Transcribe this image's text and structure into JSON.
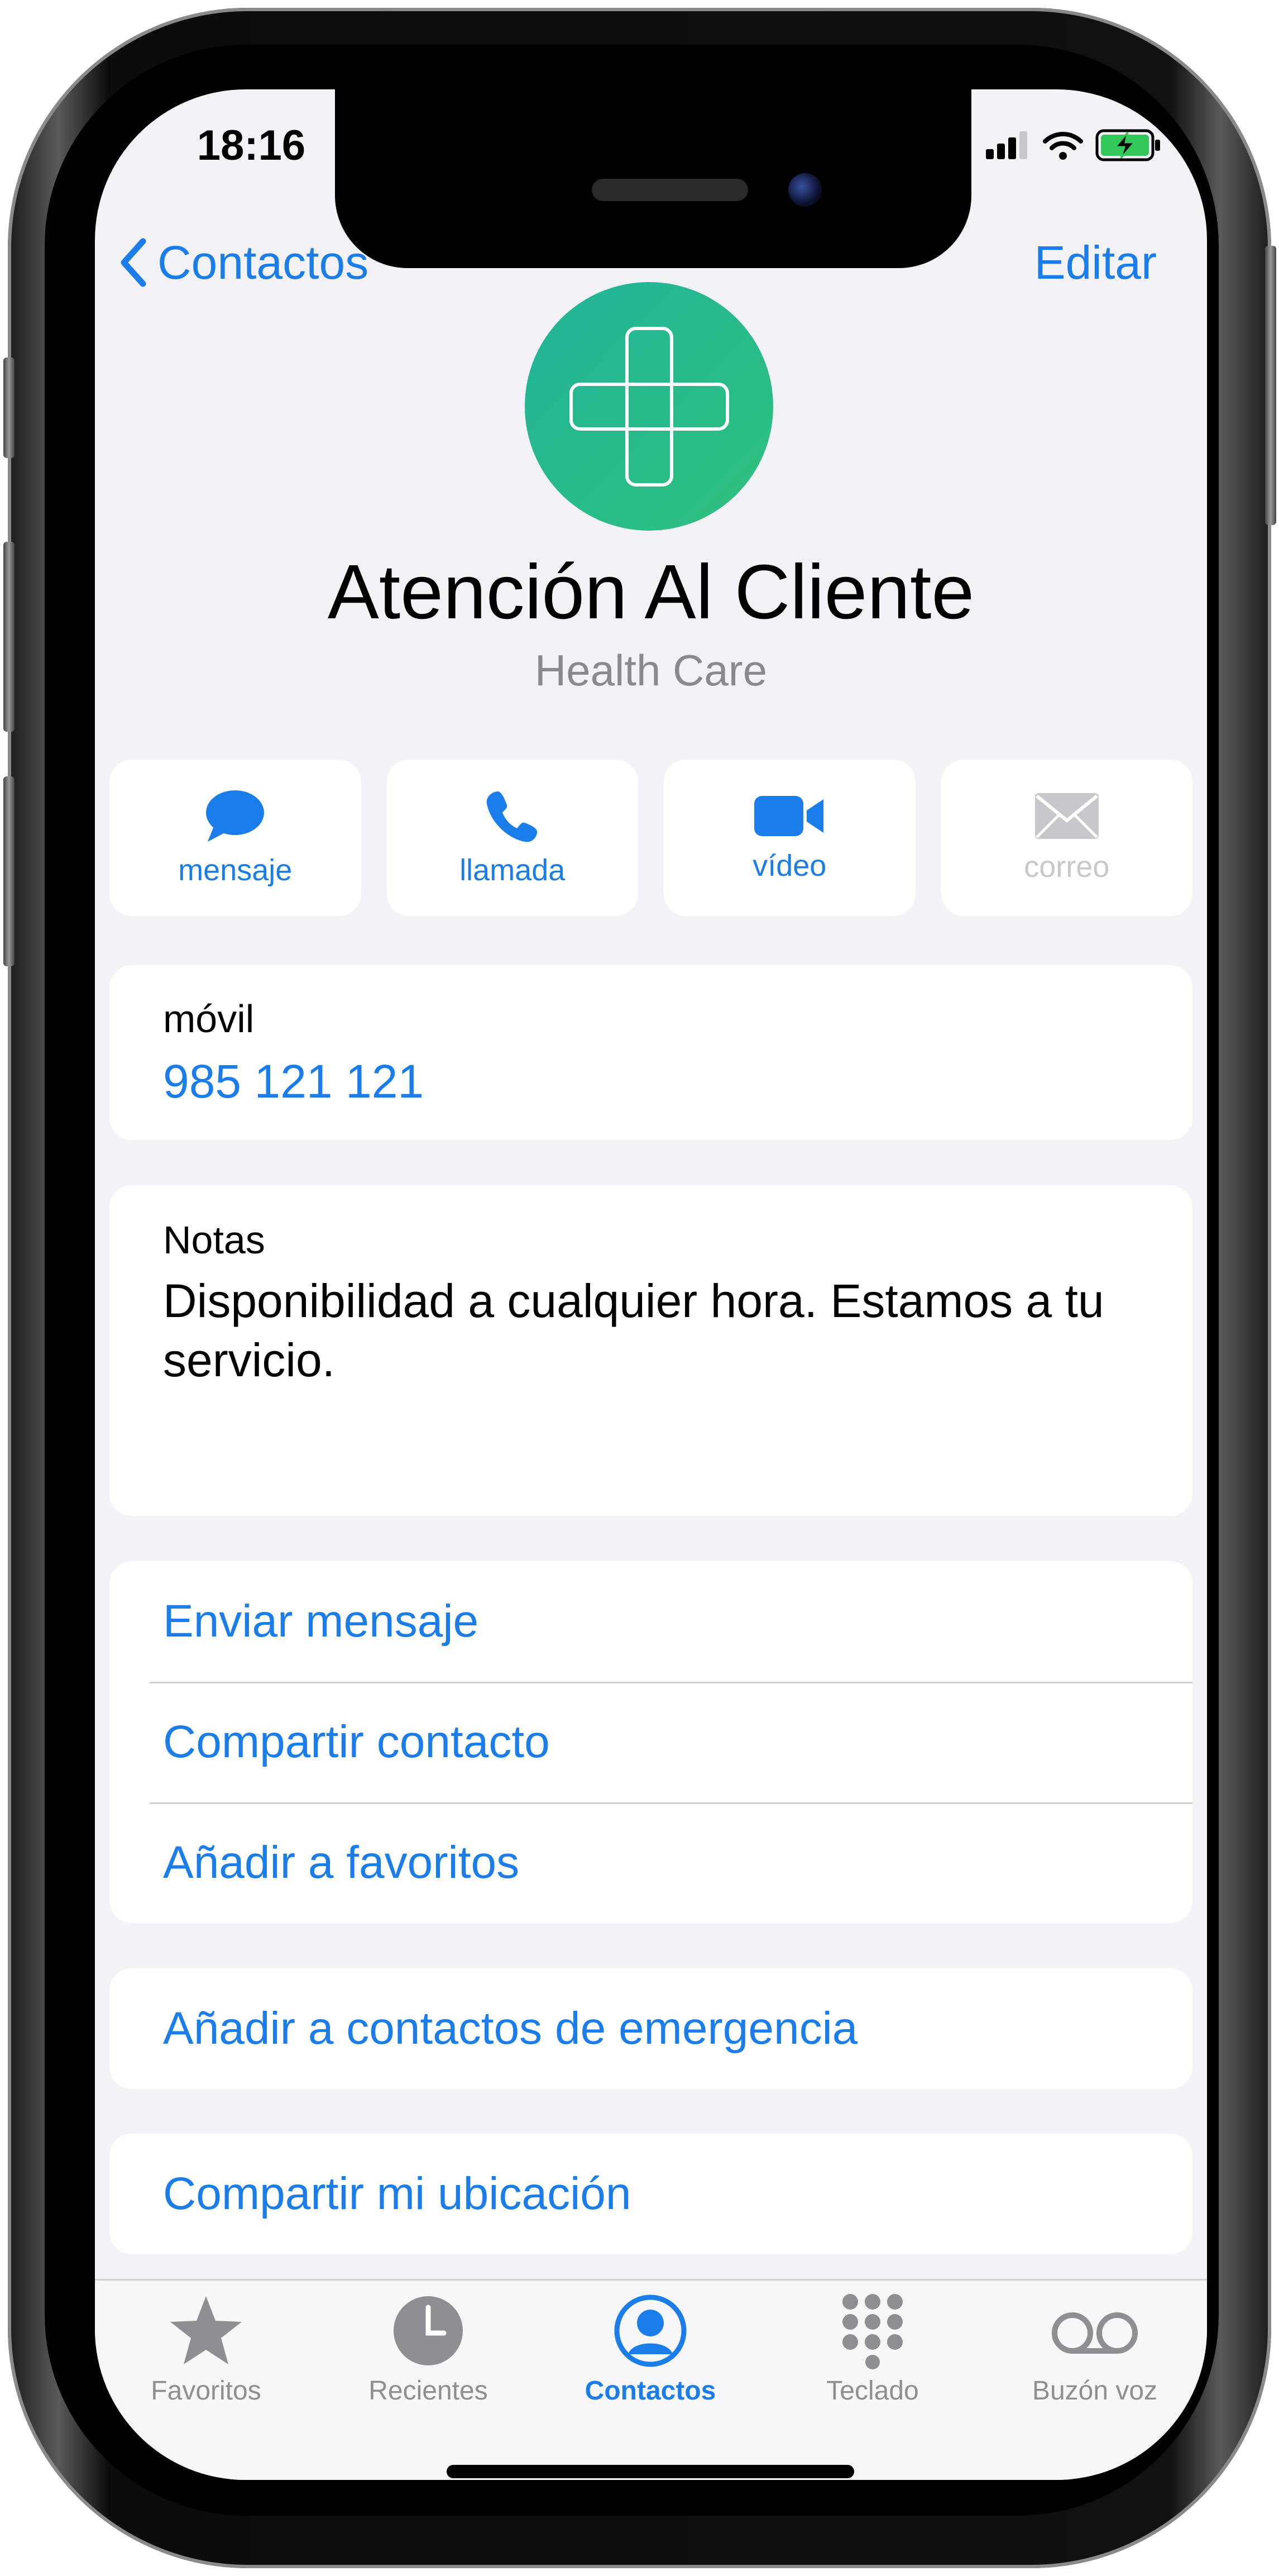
{
  "status_bar": {
    "time": "18:16"
  },
  "nav": {
    "back_label": "Contactos",
    "edit_label": "Editar"
  },
  "contact": {
    "name": "Atención Al Cliente",
    "subtitle": "Health Care"
  },
  "actions": [
    {
      "label": "mensaje",
      "icon": "message-bubble-icon",
      "enabled": true
    },
    {
      "label": "llamada",
      "icon": "phone-icon",
      "enabled": true
    },
    {
      "label": "vídeo",
      "icon": "video-camera-icon",
      "enabled": true
    },
    {
      "label": "correo",
      "icon": "mail-envelope-icon",
      "enabled": false
    }
  ],
  "phone": {
    "label": "móvil",
    "value": "985 121 121"
  },
  "notes": {
    "label": "Notas",
    "text": "Disponibilidad a cualquier hora. Estamos a tu servicio."
  },
  "options": [
    {
      "label": "Enviar mensaje"
    },
    {
      "label": "Compartir contacto"
    },
    {
      "label": "Añadir a favoritos"
    }
  ],
  "emergency": {
    "label": "Añadir a contactos de emergencia"
  },
  "location": {
    "label": "Compartir mi ubicación"
  },
  "tabs": [
    {
      "label": "Favoritos",
      "icon": "star-icon",
      "active": false
    },
    {
      "label": "Recientes",
      "icon": "clock-icon",
      "active": false
    },
    {
      "label": "Contactos",
      "icon": "person-circle-icon",
      "active": true
    },
    {
      "label": "Teclado",
      "icon": "keypad-icon",
      "active": false
    },
    {
      "label": "Buzón voz",
      "icon": "voicemail-icon",
      "active": false
    }
  ],
  "colors": {
    "accent": "#1a7dea",
    "avatar": "#26b98e",
    "background": "#f2f2f7",
    "battery": "#34c759"
  }
}
